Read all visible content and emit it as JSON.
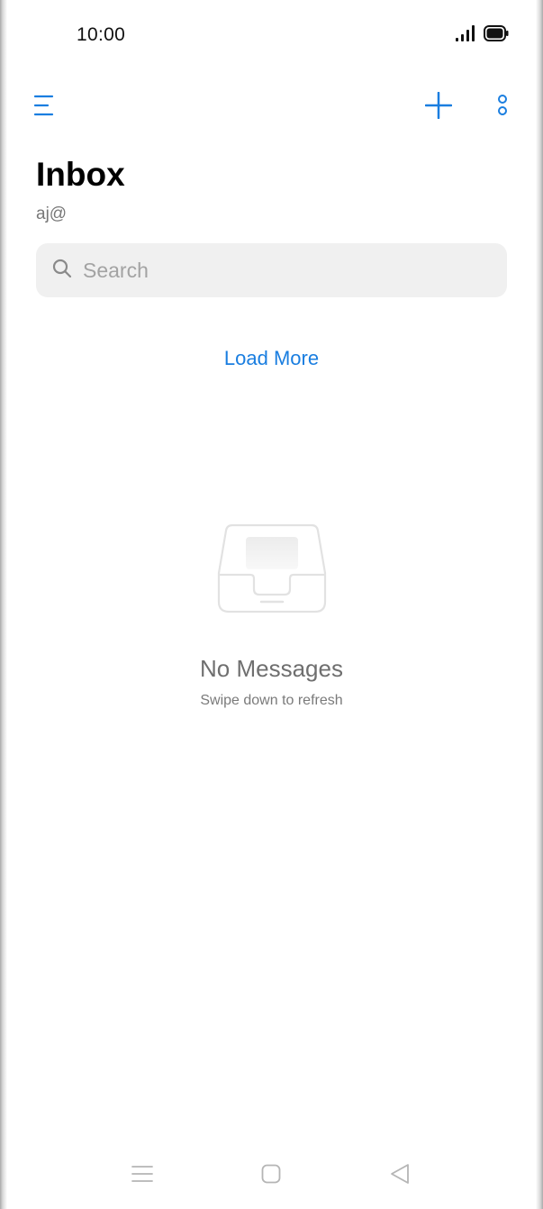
{
  "status_bar": {
    "time": "10:00",
    "icons": [
      "signal-icon",
      "battery-icon"
    ]
  },
  "toolbar": {
    "menu_icon": "menu-icon",
    "compose_icon": "plus-icon",
    "more_icon": "more-vertical-icon"
  },
  "header": {
    "title": "Inbox",
    "account": "aj@"
  },
  "search": {
    "placeholder": "Search",
    "value": "",
    "icon": "search-icon"
  },
  "list": {
    "load_more_label": "Load More"
  },
  "empty_state": {
    "icon": "inbox-tray-icon",
    "title": "No Messages",
    "hint": "Swipe down to refresh"
  },
  "nav_bar": {
    "icons": [
      "nav-menu-icon",
      "nav-home-icon",
      "nav-back-icon"
    ]
  },
  "colors": {
    "accent": "#1a7ee0",
    "search_background": "#f0f0f0",
    "muted_text": "#777777",
    "empty_icon_stroke": "#e2e2e2"
  }
}
